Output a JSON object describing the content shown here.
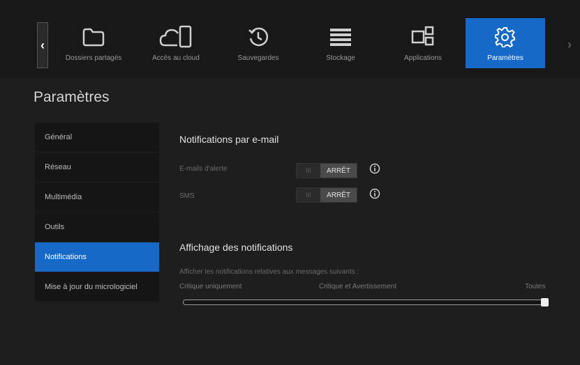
{
  "nav": {
    "prev_glyph": "‹",
    "next_glyph": "›",
    "tabs": [
      {
        "label": "Dossiers partagés",
        "icon": "folder-icon"
      },
      {
        "label": "Accès au cloud",
        "icon": "cloud-device-icon"
      },
      {
        "label": "Sauvegardes",
        "icon": "history-icon"
      },
      {
        "label": "Stockage",
        "icon": "storage-icon"
      },
      {
        "label": "Applications",
        "icon": "apps-icon"
      },
      {
        "label": "Paramètres",
        "icon": "gear-icon",
        "active": true
      }
    ]
  },
  "page_title": "Paramètres",
  "sidebar": {
    "items": [
      {
        "label": "Général"
      },
      {
        "label": "Réseau"
      },
      {
        "label": "Multimédia"
      },
      {
        "label": "Outils"
      },
      {
        "label": "Notifications",
        "active": true
      },
      {
        "label": "Mise à jour du micrologiciel"
      }
    ]
  },
  "email_section": {
    "title": "Notifications par e-mail",
    "rows": [
      {
        "label": "E-mails d'alerte",
        "knob": "III",
        "state": "ARRÊT"
      },
      {
        "label": "SMS",
        "knob": "III",
        "state": "ARRÊT"
      }
    ]
  },
  "display_section": {
    "title": "Affichage des notifications",
    "hint": "Afficher les notifications relatives aux messages suivants :",
    "levels": [
      "Critique uniquement",
      "Critique et Avertissement",
      "Toutes"
    ],
    "selected_level": "Toutes"
  },
  "colors": {
    "accent": "#1769c7",
    "background": "#1e1e1e",
    "toggle_off": "#4a4a4a"
  }
}
